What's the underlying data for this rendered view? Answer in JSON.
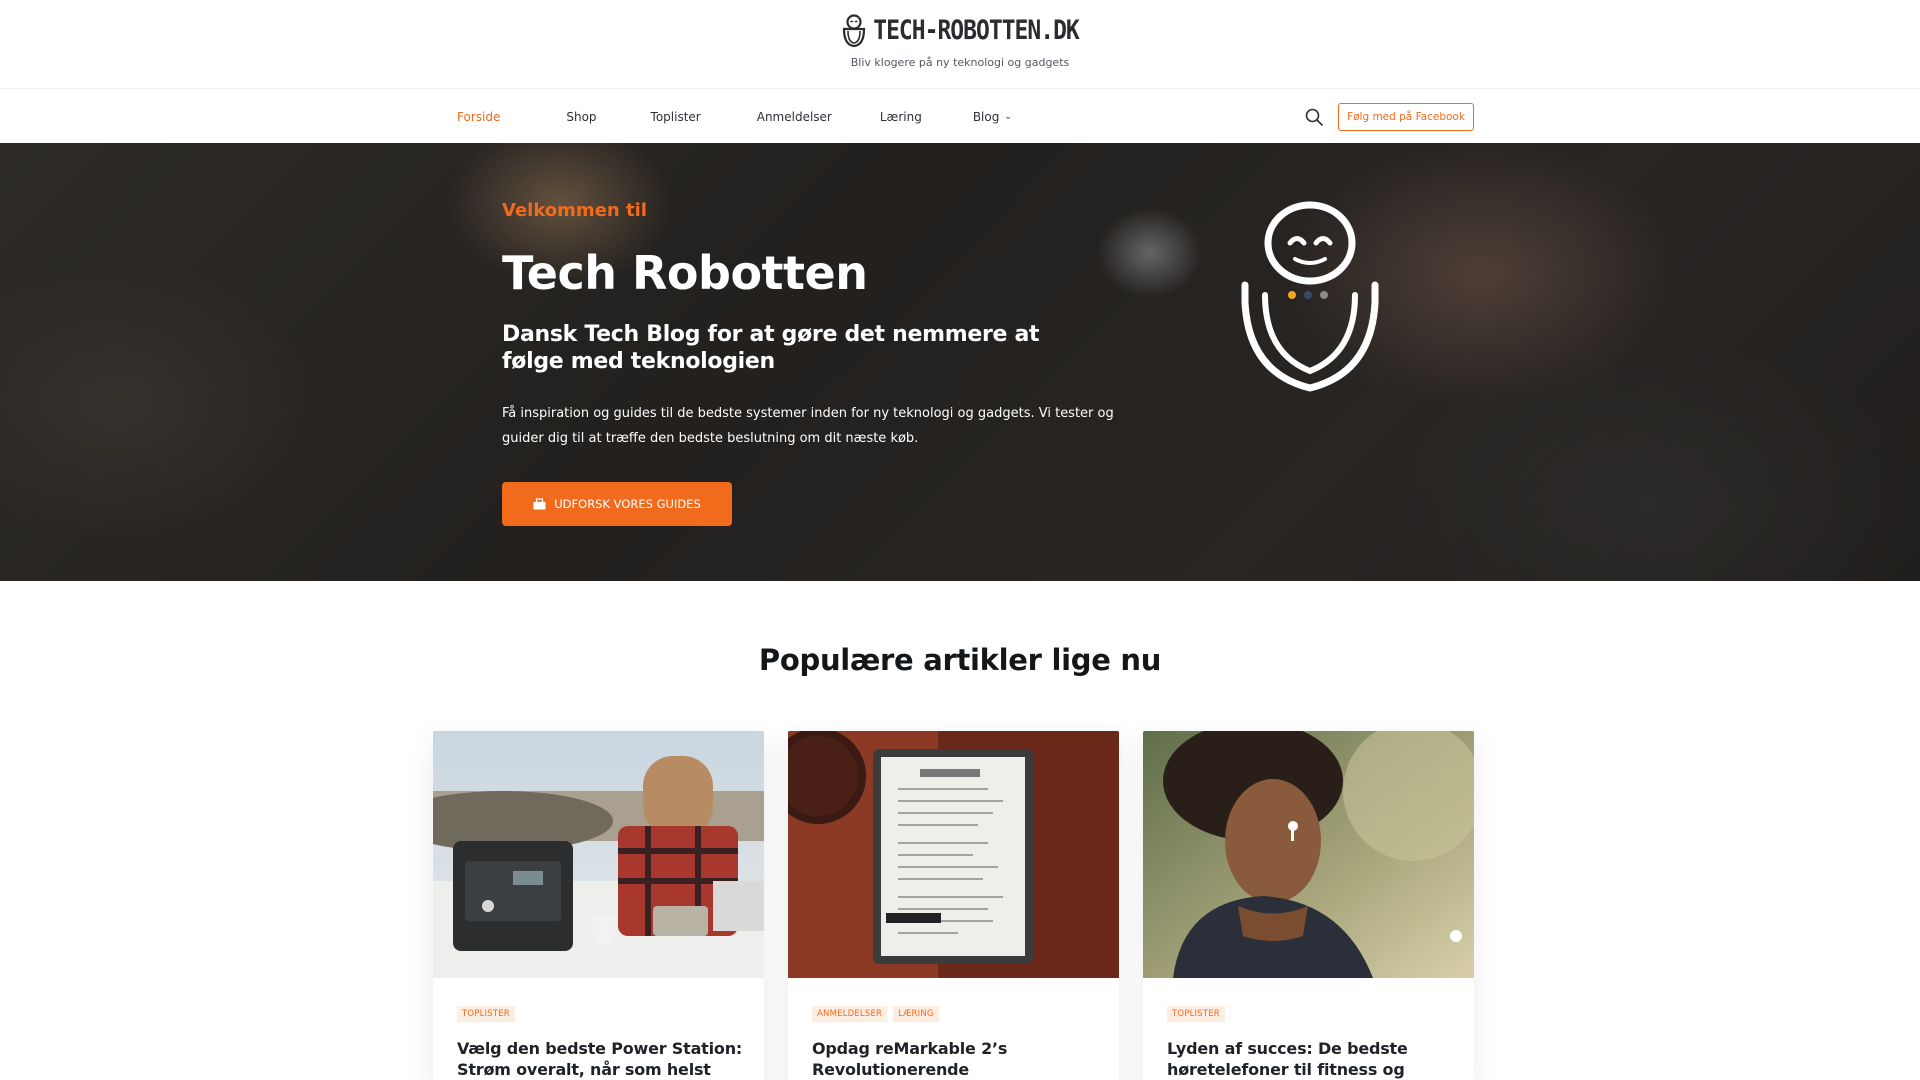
{
  "header": {
    "brand_name": "TECH-ROBOTTEN.DK",
    "tagline": "Bliv klogere på ny teknologi og gadgets",
    "logo_icon": "robot-icon"
  },
  "nav": {
    "items": [
      {
        "label": "Forside",
        "active": true
      },
      {
        "label": "Shop"
      },
      {
        "label": "Toplister"
      },
      {
        "label": "Anmeldelser"
      },
      {
        "label": "Læring"
      },
      {
        "label": "Blog",
        "has_dropdown": true
      }
    ],
    "search_icon": "search-icon",
    "facebook_button": "Følg med på Facebook"
  },
  "hero": {
    "kicker": "Velkommen til",
    "title": "Tech Robotten",
    "subtitle": "Dansk Tech Blog for at gøre det nemmere at følge med teknologien",
    "text": "Få inspiration og guides til de bedste systemer inden for ny teknologi og gadgets. Vi tester og guider dig til at træffe den bedste beslutning om dit næste køb.",
    "cta_label": "UDFORSK VORES GUIDES",
    "cta_icon": "box-icon"
  },
  "popular": {
    "title": "Populære artikler lige nu",
    "articles": [
      {
        "tags": [
          "TOPLISTER"
        ],
        "title": "Vælg den bedste Power Station: Strøm overalt, når som helst"
      },
      {
        "tags": [
          "ANMELDELSER",
          "LÆRING"
        ],
        "title": "Opdag reMarkable 2’s Revolutionerende"
      },
      {
        "tags": [
          "TOPLISTER"
        ],
        "title": "Lyden af succes: De bedste høretelefoner til fitness og motion"
      }
    ]
  },
  "colors": {
    "accent": "#f26a1b",
    "text_dark": "#1f2328",
    "tag_bg": "#fdeee4"
  }
}
